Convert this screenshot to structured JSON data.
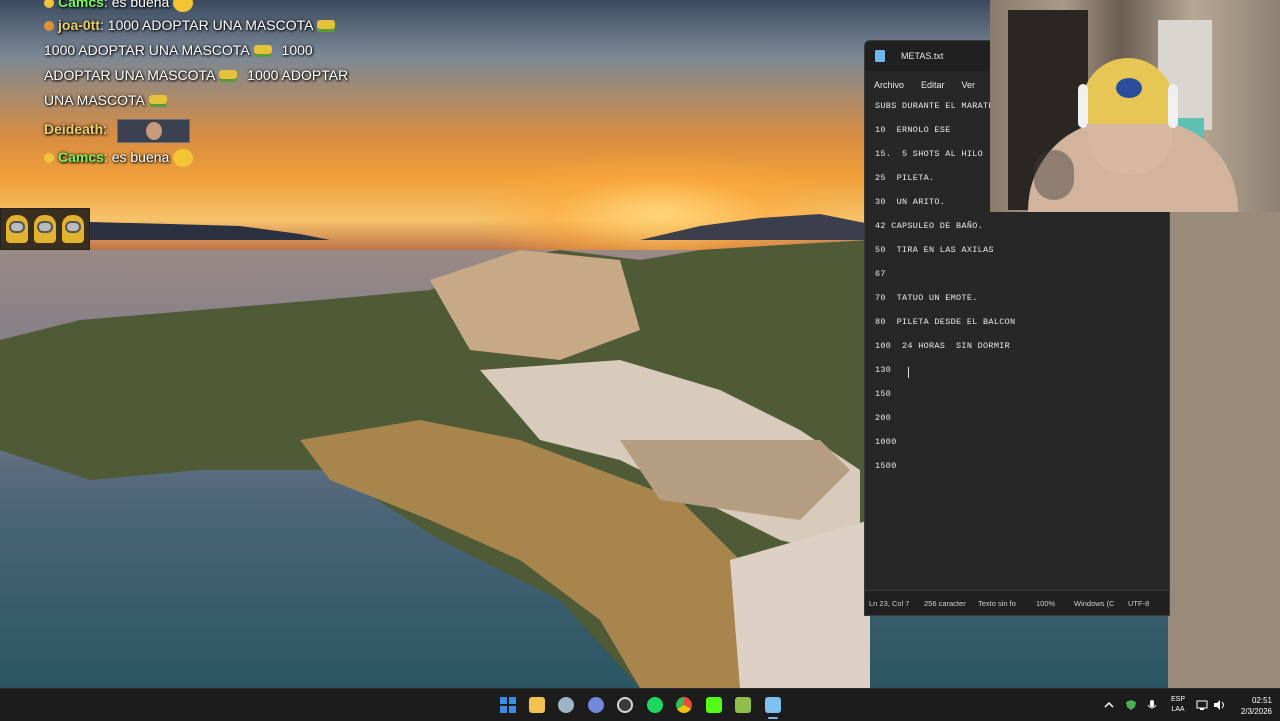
{
  "chat": {
    "lines": [
      {
        "user": "Camcs",
        "text": ": es buena"
      },
      {
        "user": "joa-0tt",
        "text": ": 1000 ADOPTAR UNA MASCOTA"
      },
      {
        "text": "1000 ADOPTAR UNA MASCOTA"
      },
      {
        "text": "1000"
      },
      {
        "text": "ADOPTAR UNA MASCOTA"
      },
      {
        "text": "1000 ADOPTAR"
      },
      {
        "text": "UNA MASCOTA"
      },
      {
        "user": "Deideath",
        "text": ":"
      },
      {
        "user": "Camcs",
        "text": ": es buena"
      }
    ]
  },
  "notepad": {
    "title": "METAS.txt",
    "menu": [
      "Archivo",
      "Editar",
      "Ver"
    ],
    "lines": [
      "SUBS DURANTE EL MARATH",
      "10  ERNOLO ESE",
      "15.  5 SHOTS AL HILO",
      "25  PILETA.",
      "30  UN ARITO.",
      "42 CAPSULEO DE BAÑO.",
      "50  TIRA EN LAS AXILAS",
      "67",
      "70  TATUO UN EMOTE.",
      "80  PILETA DESDE EL BALCON",
      "100  24 HORAS  SIN DORMIR",
      "130",
      "150",
      "200",
      "1000",
      "1500"
    ],
    "status": {
      "position": "Ln 23, Col 7",
      "chars": "256 caracter",
      "format": "Texto sin fo",
      "zoom": "100%",
      "eol": "Windows (C",
      "encoding": "UTF-8"
    }
  },
  "taskbar": {
    "apps": [
      {
        "name": "start",
        "color": "#3a8ee6"
      },
      {
        "name": "file-explorer",
        "color": "#f2c14e"
      },
      {
        "name": "steam",
        "color": "#9fb4c8"
      },
      {
        "name": "discord",
        "color": "#7289da"
      },
      {
        "name": "obs",
        "color": "#d8d8d8"
      },
      {
        "name": "spotify",
        "color": "#1ed760"
      },
      {
        "name": "chrome",
        "color": "#e74c3c"
      },
      {
        "name": "kick",
        "color": "#53fc18"
      },
      {
        "name": "app",
        "color": "#8fbf4a"
      },
      {
        "name": "notepad",
        "color": "#7ec1ef"
      }
    ],
    "language_line1": "ESP",
    "language_line2": "LAA",
    "time": "02:51",
    "date": "2/3/2026"
  }
}
